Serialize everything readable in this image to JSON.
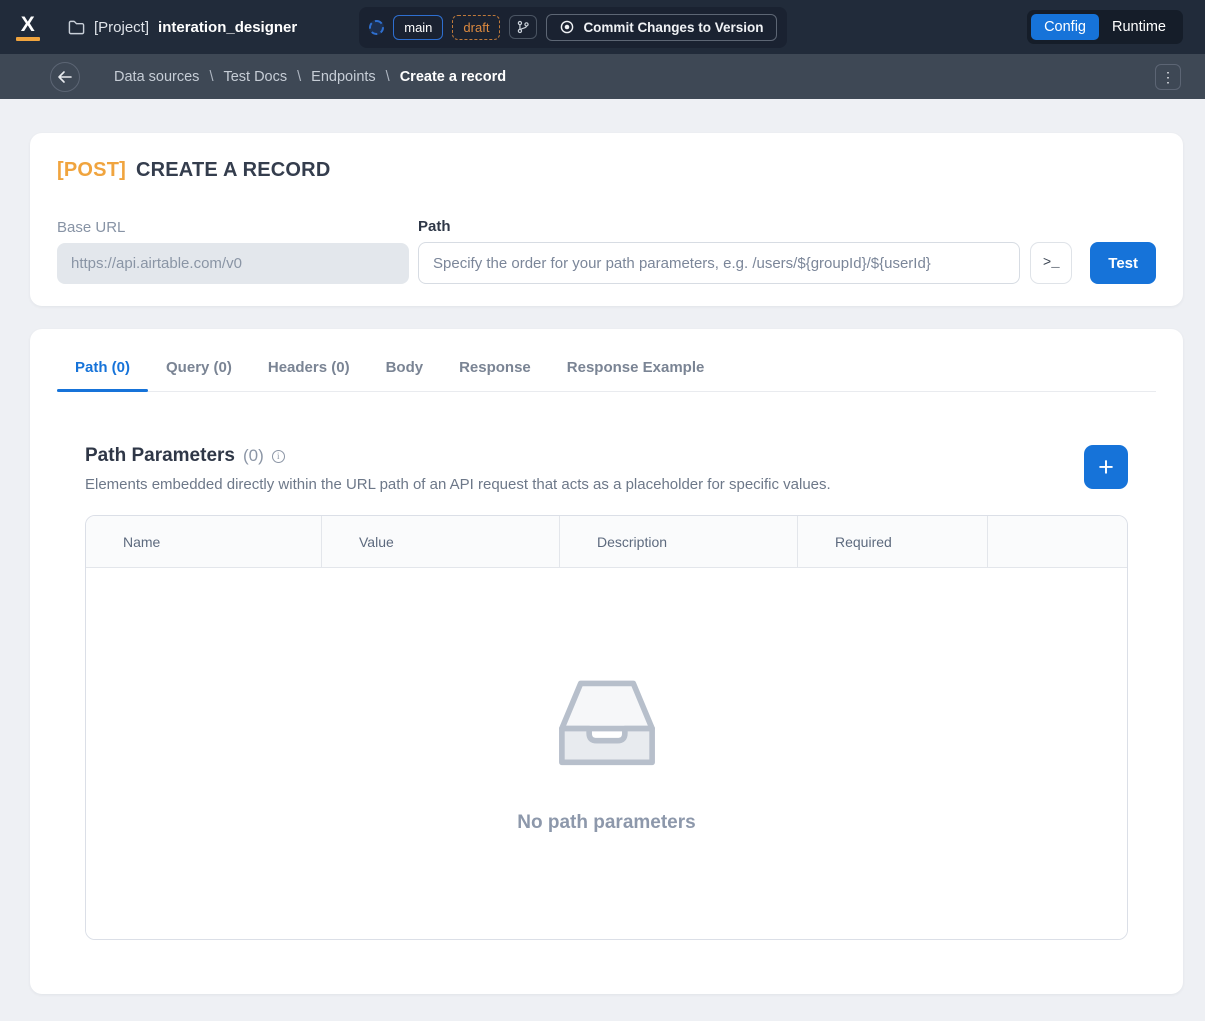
{
  "topbar": {
    "logo": "X",
    "project_prefix": "[Project]",
    "project_name": "interation_designer",
    "branch_pill": "main",
    "draft_pill": "draft",
    "commit_button": "Commit Changes to Version",
    "mode_config": "Config",
    "mode_runtime": "Runtime"
  },
  "breadcrumb": {
    "separator": "\\",
    "items": [
      "Data sources",
      "Test Docs",
      "Endpoints",
      "Create a record"
    ]
  },
  "endpoint": {
    "method": "[POST]",
    "title": "CREATE A RECORD",
    "base_url_label": "Base URL",
    "base_url_value": "https://api.airtable.com/v0",
    "path_label": "Path",
    "path_placeholder": "Specify the order for your path parameters, e.g. /users/${groupId}/${userId}",
    "test_button": "Test"
  },
  "tabs": [
    {
      "label": "Path (0)",
      "active": true
    },
    {
      "label": "Query (0)",
      "active": false
    },
    {
      "label": "Headers (0)",
      "active": false
    },
    {
      "label": "Body",
      "active": false
    },
    {
      "label": "Response",
      "active": false
    },
    {
      "label": "Response Example",
      "active": false
    }
  ],
  "path_parameters": {
    "title": "Path Parameters",
    "count": "(0)",
    "description": "Elements embedded directly within the URL path of an API request that acts as a placeholder for specific values.",
    "table": {
      "columns": [
        "Name",
        "Value",
        "Description",
        "Required",
        ""
      ],
      "rows": [],
      "empty_text": "No path parameters"
    }
  },
  "icons": {
    "kebab": "⋮",
    "terminal": ">_",
    "plus": "+",
    "info": "i"
  },
  "colors": {
    "accent_blue": "#1673d9",
    "orange": "#f0a43e",
    "draft_orange": "#dd8a3f",
    "topbar_bg": "#212b3a",
    "breadcrumb_bg": "#3e4855",
    "page_bg": "#eef0f4"
  }
}
